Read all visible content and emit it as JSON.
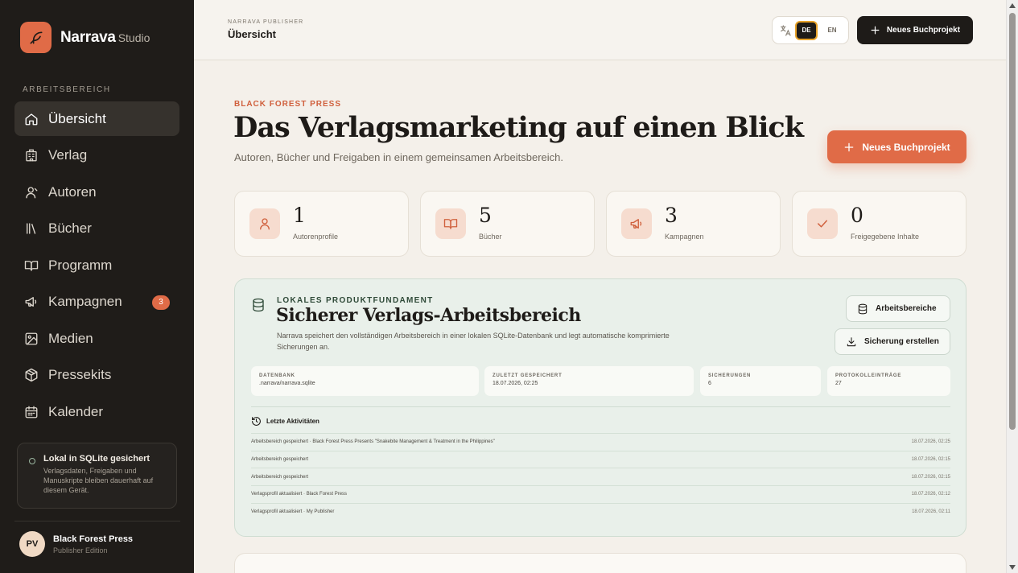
{
  "app": {
    "brand_name": "Narrava",
    "brand_suffix": "Studio"
  },
  "sidebar": {
    "section_label": "ARBEITSBEREICH",
    "items": [
      {
        "label": "Übersicht",
        "icon": "home-icon",
        "active": true
      },
      {
        "label": "Verlag",
        "icon": "building-icon"
      },
      {
        "label": "Autoren",
        "icon": "user-icon"
      },
      {
        "label": "Bücher",
        "icon": "library-icon"
      },
      {
        "label": "Programm",
        "icon": "book-open-icon"
      },
      {
        "label": "Kampagnen",
        "icon": "megaphone-icon",
        "badge": "3"
      },
      {
        "label": "Medien",
        "icon": "image-icon"
      },
      {
        "label": "Pressekits",
        "icon": "package-icon"
      },
      {
        "label": "Kalender",
        "icon": "calendar-icon"
      }
    ],
    "local_box": {
      "title": "Lokal in SQLite gesichert",
      "text": "Verlagsdaten, Freigaben und Manuskripte bleiben dauerhaft auf diesem Gerät."
    },
    "user": {
      "initials": "PV",
      "name": "Black Forest Press",
      "edition": "Publisher Edition"
    }
  },
  "topbar": {
    "eyebrow": "NARRAVA PUBLISHER",
    "title": "Übersicht",
    "lang_de": "DE",
    "lang_en": "EN",
    "new_project": "Neues Buchprojekt"
  },
  "hero": {
    "eyebrow": "BLACK FOREST PRESS",
    "title": "Das Verlagsmarketing auf einen Blick",
    "lead": "Autoren, Bücher und Freigaben in einem gemeinsamen Arbeitsbereich.",
    "button": "Neues Buchprojekt"
  },
  "stats": [
    {
      "value": "1",
      "label": "Autorenprofile",
      "icon": "user-icon"
    },
    {
      "value": "5",
      "label": "Bücher",
      "icon": "book-open-icon"
    },
    {
      "value": "3",
      "label": "Kampagnen",
      "icon": "megaphone-icon"
    },
    {
      "value": "0",
      "label": "Freigegebene Inhalte",
      "icon": "check-icon"
    }
  ],
  "foundation": {
    "eyebrow": "LOKALES PRODUKTFUNDAMENT",
    "title": "Sicherer Verlags-Arbeitsbereich",
    "text": "Narrava speichert den vollständigen Arbeitsbereich in einer lokalen SQLite-Datenbank und legt automatische komprimierte Sicherungen an.",
    "btn_workspaces": "Arbeitsbereiche",
    "btn_backup": "Sicherung erstellen",
    "meta": [
      {
        "key": "DATENBANK",
        "value": ".narrava/narrava.sqlite"
      },
      {
        "key": "ZULETZT GESPEICHERT",
        "value": "18.07.2026, 02:25"
      },
      {
        "key": "SICHERUNGEN",
        "value": "6"
      },
      {
        "key": "PROTOKOLLEINTRÄGE",
        "value": "27"
      }
    ],
    "activity_title": "Letzte Aktivitäten",
    "activity": [
      {
        "text": "Arbeitsbereich gespeichert · Black Forest Press Presents \"Snakebite Management & Treatment in the Philippines\"",
        "time": "18.07.2026, 02:25"
      },
      {
        "text": "Arbeitsbereich gespeichert",
        "time": "18.07.2026, 02:15"
      },
      {
        "text": "Arbeitsbereich gespeichert",
        "time": "18.07.2026, 02:15"
      },
      {
        "text": "Verlagsprofil aktualisiert · Black Forest Press",
        "time": "18.07.2026, 02:12"
      },
      {
        "text": "Verlagsprofil aktualisiert · My Publisher",
        "time": "18.07.2026, 02:11"
      }
    ]
  },
  "colors": {
    "accent": "#e06b47",
    "sidebar_bg": "#1f1c19",
    "page_bg": "#f4f0ea",
    "foundation_bg": "#e9f0ea"
  }
}
